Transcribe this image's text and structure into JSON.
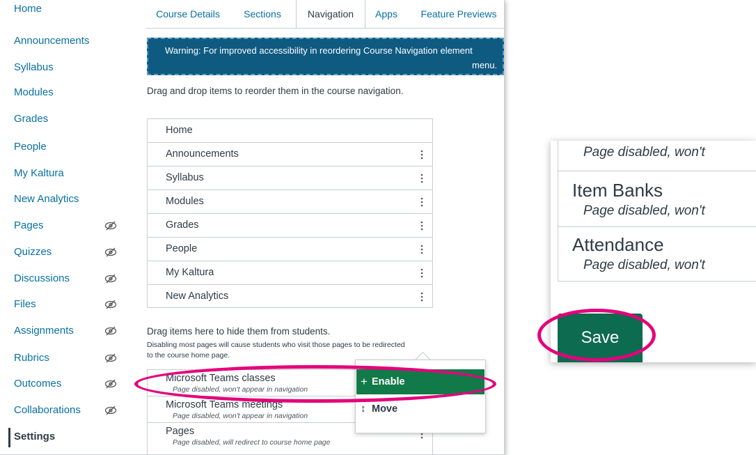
{
  "sidebar": {
    "items": [
      {
        "label": "Home",
        "hidden": false
      },
      {
        "label": "Announcements",
        "hidden": false
      },
      {
        "label": "Syllabus",
        "hidden": false
      },
      {
        "label": "Modules",
        "hidden": false
      },
      {
        "label": "Grades",
        "hidden": false
      },
      {
        "label": "People",
        "hidden": false
      },
      {
        "label": "My Kaltura",
        "hidden": false
      },
      {
        "label": "New Analytics",
        "hidden": false
      },
      {
        "label": "Pages",
        "hidden": true
      },
      {
        "label": "Quizzes",
        "hidden": true
      },
      {
        "label": "Discussions",
        "hidden": true
      },
      {
        "label": "Files",
        "hidden": true
      },
      {
        "label": "Assignments",
        "hidden": true
      },
      {
        "label": "Rubrics",
        "hidden": true
      },
      {
        "label": "Outcomes",
        "hidden": true
      },
      {
        "label": "Collaborations",
        "hidden": true
      },
      {
        "label": "Settings",
        "hidden": false
      }
    ],
    "active": "Settings"
  },
  "tabs": [
    {
      "label": "Course Details"
    },
    {
      "label": "Sections"
    },
    {
      "label": "Navigation"
    },
    {
      "label": "Apps"
    },
    {
      "label": "Feature Previews"
    }
  ],
  "active_tab": "Navigation",
  "warning": {
    "line1": "Warning: For improved accessibility in reordering Course Navigation element",
    "line2": "menu."
  },
  "instructions": "Drag and drop items to reorder them in the course navigation.",
  "nav_items": [
    {
      "label": "Home",
      "menu": false
    },
    {
      "label": "Announcements",
      "menu": true
    },
    {
      "label": "Syllabus",
      "menu": true
    },
    {
      "label": "Modules",
      "menu": true
    },
    {
      "label": "Grades",
      "menu": true
    },
    {
      "label": "People",
      "menu": true
    },
    {
      "label": "My Kaltura",
      "menu": true
    },
    {
      "label": "New Analytics",
      "menu": true
    }
  ],
  "hidden_section": {
    "title": "Drag items here to hide them from students.",
    "note_line1": "Disabling most pages will cause students who visit those pages to be redirected",
    "note_line2": "to the course home page.",
    "items": [
      {
        "label": "Microsoft Teams classes",
        "note": "Page disabled, won't appear in navigation"
      },
      {
        "label": "Microsoft Teams meetings",
        "note": "Page disabled, won't appear in navigation"
      },
      {
        "label": "Pages",
        "note": "Page disabled, will redirect to course home page"
      }
    ]
  },
  "popup_menu": {
    "enable_label": "Enable",
    "move_label": "Move"
  },
  "zoom": {
    "top_note": "Page disabled, won't",
    "rows": [
      {
        "label": "Item Banks",
        "note": "Page disabled, won't"
      },
      {
        "label": "Attendance",
        "note": "Page disabled, won't"
      }
    ],
    "save_label": "Save"
  },
  "colors": {
    "link": "#0770a3",
    "text": "#2d3b45",
    "warning_bg": "#0f5a80",
    "enable_bg": "#127a48",
    "save_bg": "#0d6b4f",
    "highlight": "#e4007c"
  }
}
